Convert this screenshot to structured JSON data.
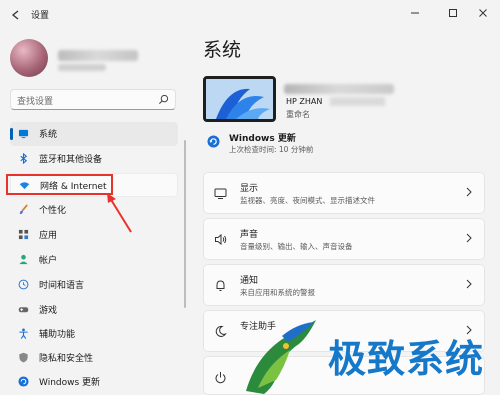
{
  "window": {
    "title": "设置",
    "controls": [
      "minimize-icon",
      "maximize-icon",
      "close-icon"
    ]
  },
  "search": {
    "placeholder": "查找设置"
  },
  "sidebar": {
    "items": [
      {
        "label": "系统",
        "icon": "monitor-icon",
        "selected": true
      },
      {
        "label": "蓝牙和其他设备",
        "icon": "bluetooth-icon"
      },
      {
        "label": "网络 & Internet",
        "icon": "wifi-icon",
        "highlighted": true
      },
      {
        "label": "个性化",
        "icon": "brush-icon"
      },
      {
        "label": "应用",
        "icon": "apps-icon"
      },
      {
        "label": "帐户",
        "icon": "person-icon"
      },
      {
        "label": "时间和语言",
        "icon": "globe-clock-icon"
      },
      {
        "label": "游戏",
        "icon": "gamepad-icon"
      },
      {
        "label": "辅助功能",
        "icon": "accessibility-icon"
      },
      {
        "label": "隐私和安全性",
        "icon": "shield-icon"
      },
      {
        "label": "Windows 更新",
        "icon": "update-icon"
      }
    ]
  },
  "main": {
    "title": "系统",
    "device": {
      "name": "HP ZHAN",
      "rename": "重命名"
    },
    "update": {
      "title": "Windows 更新",
      "subtitle": "上次检查时间: 10 分钟前"
    },
    "cards": [
      {
        "title": "显示",
        "desc": "监视器、亮度、夜间模式、显示描述文件",
        "icon": "display-icon"
      },
      {
        "title": "声音",
        "desc": "音量级别、输出、输入、声音设备",
        "icon": "speaker-icon"
      },
      {
        "title": "通知",
        "desc": "来自应用和系统的警报",
        "icon": "bell-icon"
      },
      {
        "title": "专注助手",
        "desc": "",
        "icon": "moon-icon"
      },
      {
        "title": "",
        "desc": "",
        "icon": "power-icon"
      }
    ]
  },
  "watermark": {
    "text": "极致系统"
  },
  "colors": {
    "accent": "#005fb8",
    "highlight_box": "#e8332c",
    "watermark": "#1578c9"
  }
}
